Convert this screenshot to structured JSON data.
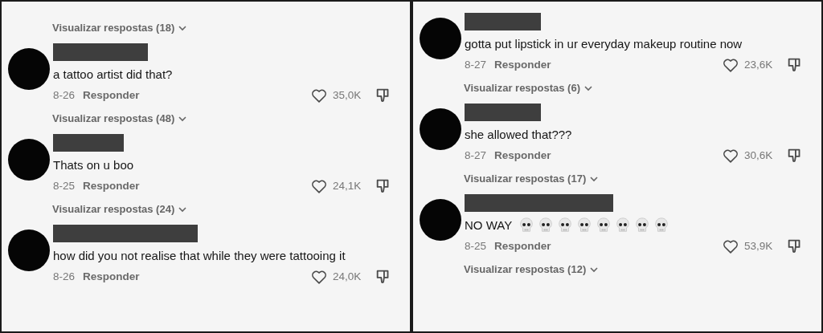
{
  "panels": [
    {
      "items": [
        {
          "kind": "replies",
          "label": "Visualizar respostas (18)"
        },
        {
          "kind": "comment",
          "text": "a tattoo artist did that?",
          "date": "8-26",
          "reply": "Responder",
          "likes": "35,0K"
        },
        {
          "kind": "replies",
          "label": "Visualizar respostas (48)"
        },
        {
          "kind": "comment",
          "text": "Thats on u boo",
          "date": "8-25",
          "reply": "Responder",
          "likes": "24,1K"
        },
        {
          "kind": "replies",
          "label": "Visualizar respostas (24)"
        },
        {
          "kind": "comment",
          "text": "how did you not realise that while they were tattooing it",
          "date": "8-26",
          "reply": "Responder",
          "likes": "24,0K"
        }
      ]
    },
    {
      "items": [
        {
          "kind": "comment",
          "text": "gotta put lipstick in ur everyday makeup routine now",
          "date": "8-27",
          "reply": "Responder",
          "likes": "23,6K"
        },
        {
          "kind": "replies",
          "label": "Visualizar respostas (6)"
        },
        {
          "kind": "comment",
          "text": "she allowed that???",
          "date": "8-27",
          "reply": "Responder",
          "likes": "30,6K"
        },
        {
          "kind": "replies",
          "label": "Visualizar respostas (17)"
        },
        {
          "kind": "comment",
          "text": "NO WAY",
          "emoji": [
            {
              "kind": "skull"
            },
            {
              "kind": "skull"
            },
            {
              "kind": "skull"
            },
            {
              "kind": "skull"
            },
            {
              "kind": "skull"
            },
            {
              "kind": "skull"
            },
            {
              "kind": "skull"
            },
            {
              "kind": "skull"
            }
          ],
          "date": "8-25",
          "reply": "Responder",
          "likes": "53,9K"
        },
        {
          "kind": "replies",
          "label": "Visualizar respostas (12)"
        }
      ]
    }
  ]
}
